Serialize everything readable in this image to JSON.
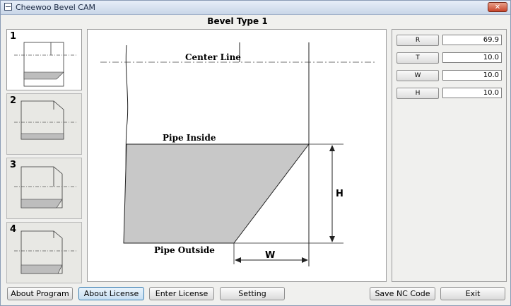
{
  "window": {
    "title": "Cheewoo Bevel CAM",
    "close_glyph": "✕"
  },
  "heading": "Bevel Type 1",
  "thumbnails": [
    {
      "number": "1",
      "active": true
    },
    {
      "number": "2",
      "active": false
    },
    {
      "number": "3",
      "active": false
    },
    {
      "number": "4",
      "active": false
    }
  ],
  "drawing": {
    "center_line": "Center Line",
    "pipe_inside": "Pipe Inside",
    "pipe_outside": "Pipe Outside",
    "dim_h": "H",
    "dim_w": "W"
  },
  "params": [
    {
      "label": "R",
      "value": "69.9"
    },
    {
      "label": "T",
      "value": "10.0"
    },
    {
      "label": "W",
      "value": "10.0"
    },
    {
      "label": "H",
      "value": "10.0"
    }
  ],
  "buttons": {
    "about_program": "About Program",
    "about_license": "About License",
    "enter_license": "Enter License",
    "setting": "Setting",
    "save_nc": "Save NC Code",
    "exit": "Exit"
  },
  "colors": {
    "fill": "#c8c8c8",
    "accent": "#3c7fb1"
  }
}
